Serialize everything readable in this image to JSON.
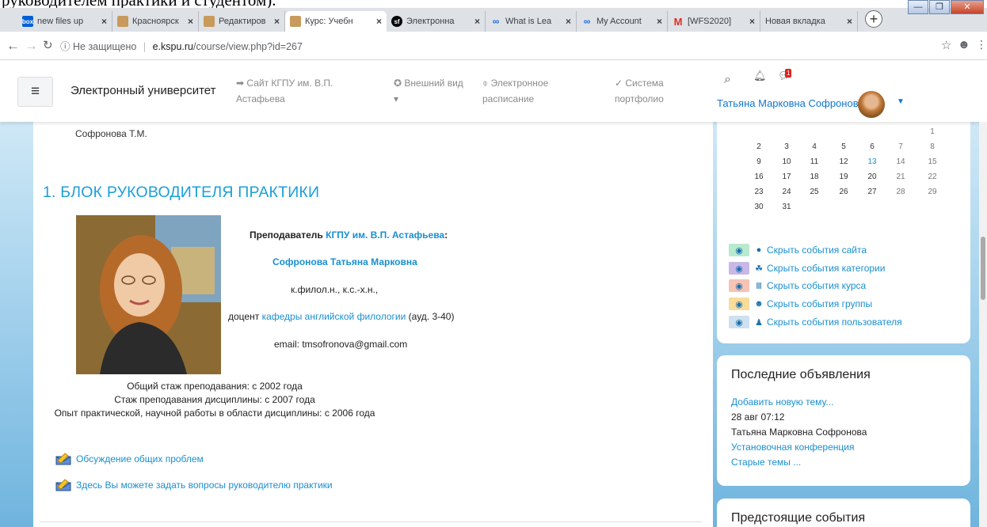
{
  "doc": {
    "clipped_text": "руководителем практики и студентом)."
  },
  "browser": {
    "tabs": [
      {
        "label": "new files up",
        "icon": "box-icon",
        "color": "#0061d5"
      },
      {
        "label": "Красноярск",
        "icon": "building-icon",
        "color": "#b07b3a"
      },
      {
        "label": "Редактиров",
        "icon": "building-icon",
        "color": "#b07b3a"
      },
      {
        "label": "Курс: Учебн",
        "icon": "building-icon",
        "color": "#b07b3a",
        "active": true
      },
      {
        "label": "Электронна",
        "icon": "symfony-icon",
        "color": "#000000"
      },
      {
        "label": "What is Lea",
        "icon": "infinity-icon",
        "color": "#1c6ce0"
      },
      {
        "label": "My Account",
        "icon": "infinity-icon",
        "color": "#1c6ce0"
      },
      {
        "label": "[WFS2020]",
        "icon": "gmail-icon",
        "color": "#d93025"
      },
      {
        "label": "Новая вкладка",
        "icon": "",
        "color": ""
      }
    ],
    "address": {
      "security": "Не защищено",
      "host": "e.kspu.ru",
      "path": "/course/view.php?id=267"
    }
  },
  "navbar": {
    "brand": "Электронный университет",
    "links": [
      {
        "line1": "➡ Сайт КГПУ им. В.П.",
        "line2": "Астафьева"
      },
      {
        "line1": "✪ Внешний вид",
        "line2": "▾"
      },
      {
        "line1": "⌽ Электронное",
        "line2": "расписание"
      },
      {
        "line1": "✓ Система",
        "line2": "портфолио"
      }
    ],
    "user_name": "Татьяна Марковна Софронова",
    "messages_badge": "1"
  },
  "main": {
    "top_clip_text": "Софронова Т.М.",
    "section_title": "1. БЛОК РУКОВОДИТЕЛЯ ПРАКТИКИ",
    "teacher": {
      "role_prefix": "Преподаватель",
      "role_link": "КГПУ им. В.П. Астафьева",
      "role_suffix": ":",
      "name": "Софронова Татьяна Марковна",
      "degree": "к.филол.н., к.с.-х.н.,",
      "position_prefix": "доцент",
      "position_link": "кафедры английской филологии",
      "position_suffix": "(ауд. 3-40)",
      "email": "email: tmsofronova@gmail.com"
    },
    "stats": [
      "Общий стаж преподавания: с 2002 года",
      "Стаж преподавания дисциплины: с 2007 года",
      "Опыт практической, научной работы в области дисциплины: с 2006 года"
    ],
    "forums": [
      "Обсуждение общих проблем",
      "Здесь Вы можете задать вопросы руководителю практики"
    ]
  },
  "calendar": {
    "rows": [
      [
        "",
        "",
        "",
        "",
        "",
        "",
        "1"
      ],
      [
        "2",
        "3",
        "4",
        "5",
        "6",
        "7",
        "8"
      ],
      [
        "9",
        "10",
        "11",
        "12",
        "13",
        "14",
        "15"
      ],
      [
        "16",
        "17",
        "18",
        "19",
        "20",
        "21",
        "22"
      ],
      [
        "23",
        "24",
        "25",
        "26",
        "27",
        "28",
        "29"
      ],
      [
        "30",
        "31",
        "",
        "",
        "",
        "",
        ""
      ]
    ],
    "event_toggles": [
      {
        "label": "Скрыть события сайта",
        "color": "#b8ead0",
        "icon": "globe-icon"
      },
      {
        "label": "Скрыть события категории",
        "color": "#c9b8e6",
        "icon": "cubes-icon"
      },
      {
        "label": "Скрыть события курса",
        "color": "#f6c3b4",
        "icon": "university-icon"
      },
      {
        "label": "Скрыть события группы",
        "color": "#f8dc9a",
        "icon": "users-icon"
      },
      {
        "label": "Скрыть события пользователя",
        "color": "#cfe0ef",
        "icon": "user-icon"
      }
    ]
  },
  "announcements": {
    "title": "Последние объявления",
    "add_link": "Добавить новую тему...",
    "date": "28 авг 07:12",
    "author": "Татьяна Марковна Софронова",
    "topic": "Установочная конференция",
    "old": "Старые темы ..."
  },
  "upcoming": {
    "title": "Предстоящие события"
  }
}
